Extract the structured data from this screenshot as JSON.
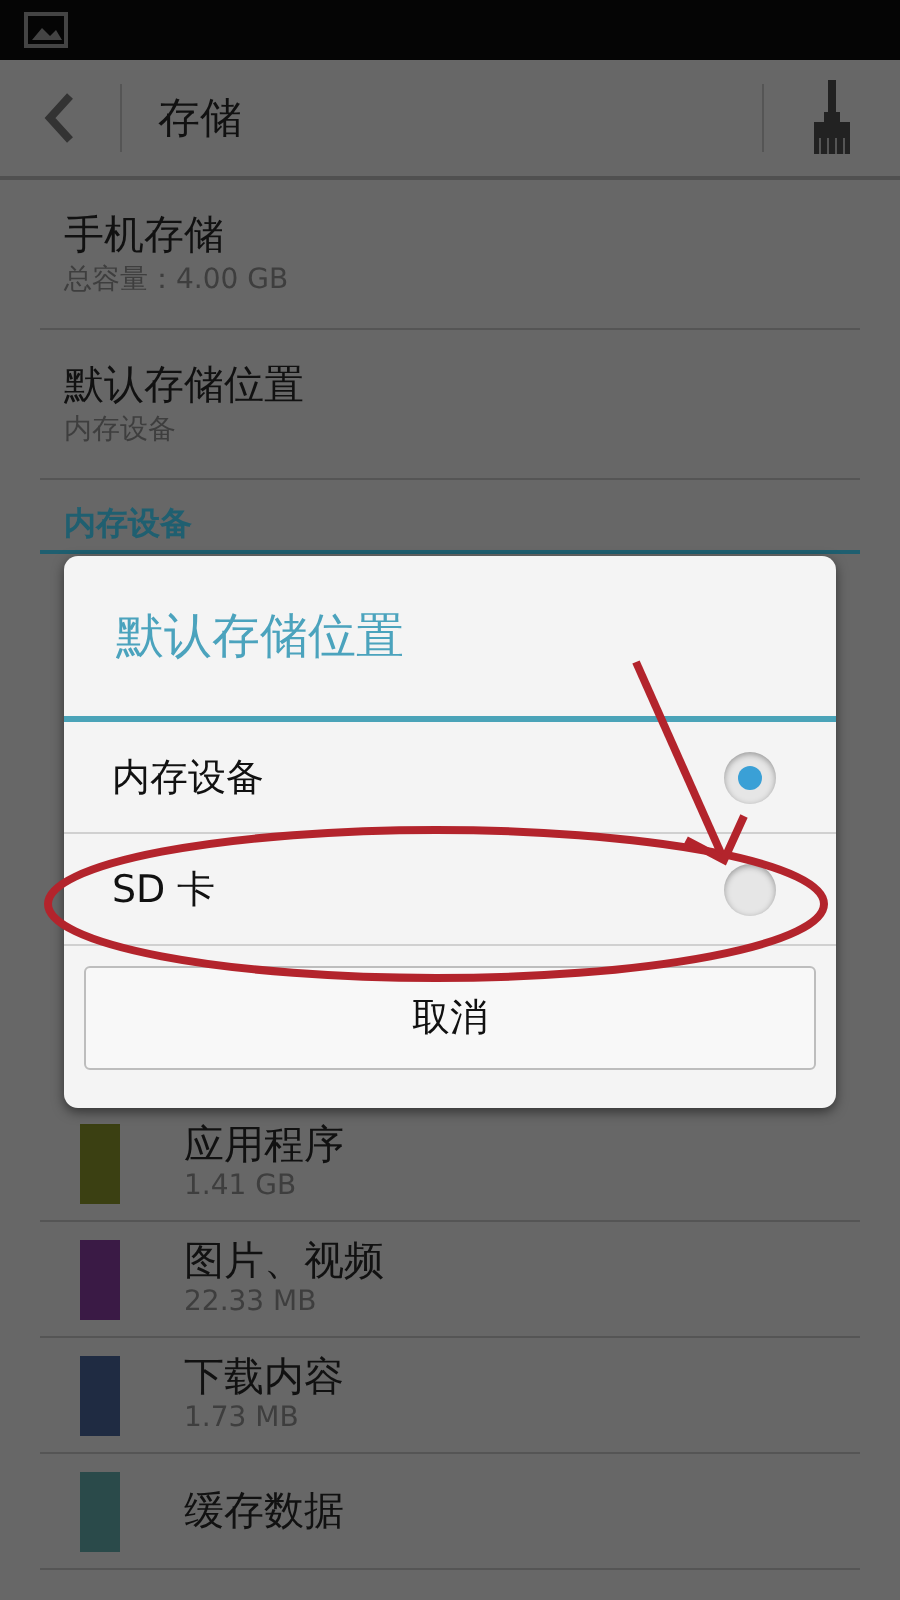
{
  "header": {
    "title": "存储"
  },
  "settings": [
    {
      "title": "手机存储",
      "subtitle": "总容量：4.00 GB"
    },
    {
      "title": "默认存储位置",
      "subtitle": "内存设备"
    }
  ],
  "section": {
    "title": "内存设备"
  },
  "storage_items": [
    {
      "label": "应用程序",
      "size": "1.41 GB",
      "color": "#3b4012"
    },
    {
      "label": "图片、视频",
      "size": "22.33 MB",
      "color": "#3a1a45"
    },
    {
      "label": "下载内容",
      "size": "1.73 MB",
      "color": "#1f2b42"
    },
    {
      "label": "缓存数据",
      "color": "#2a4a4a"
    }
  ],
  "dialog": {
    "title": "默认存储位置",
    "options": [
      {
        "label": "内存设备",
        "selected": true
      },
      {
        "label": "SD 卡",
        "selected": false
      }
    ],
    "cancel": "取消"
  }
}
